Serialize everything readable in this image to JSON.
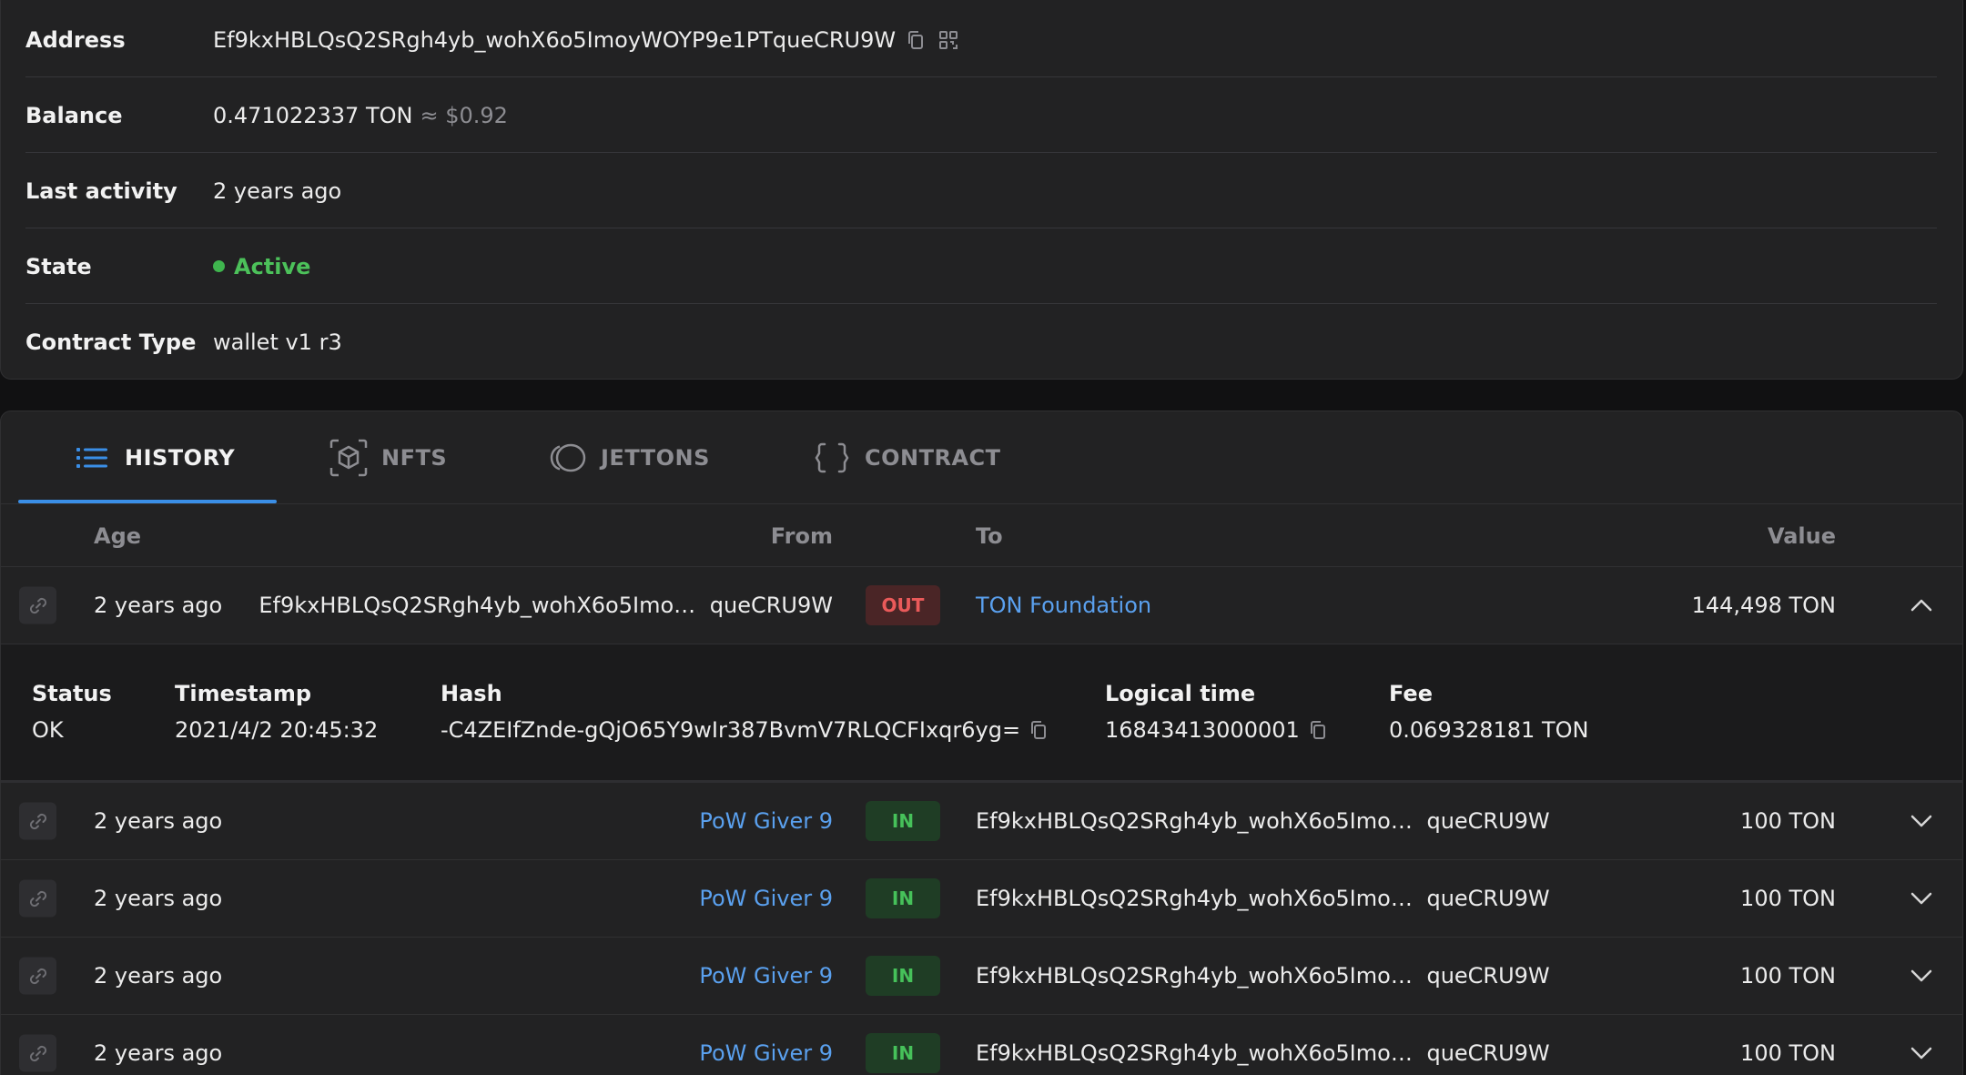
{
  "account": {
    "address_label": "Address",
    "address": "Ef9kxHBLQsQ2SRgh4yb_wohX6o5ImoyWOYP9e1PTqueCRU9W",
    "balance_label": "Balance",
    "balance": "0.471022337 TON",
    "balance_usd": "≈ $0.92",
    "last_activity_label": "Last activity",
    "last_activity": "2 years ago",
    "state_label": "State",
    "state": "Active",
    "contract_type_label": "Contract Type",
    "contract_type": "wallet v1 r3"
  },
  "tabs": [
    {
      "label": "HISTORY",
      "icon": "list-icon",
      "active": true
    },
    {
      "label": "NFTS",
      "icon": "cube-icon",
      "active": false
    },
    {
      "label": "JETTONS",
      "icon": "coins-icon",
      "active": false
    },
    {
      "label": "CONTRACT",
      "icon": "braces-icon",
      "active": false
    }
  ],
  "table": {
    "columns": {
      "age": "Age",
      "from": "From",
      "to": "To",
      "value": "Value"
    },
    "rows": [
      {
        "age": "2 years ago",
        "from_a": "Ef9kxHBLQsQ2SRgh4yb_wohX6o5Imo…",
        "from_b": "queCRU9W",
        "direction": "OUT",
        "to": "TON Foundation",
        "value": "144,498 TON"
      },
      {
        "age": "2 years ago",
        "from": "PoW Giver 9",
        "direction": "IN",
        "to_a": "Ef9kxHBLQsQ2SRgh4yb_wohX6o5Imo…",
        "to_b": "queCRU9W",
        "value": "100 TON"
      },
      {
        "age": "2 years ago",
        "from": "PoW Giver 9",
        "direction": "IN",
        "to_a": "Ef9kxHBLQsQ2SRgh4yb_wohX6o5Imo…",
        "to_b": "queCRU9W",
        "value": "100 TON"
      },
      {
        "age": "2 years ago",
        "from": "PoW Giver 9",
        "direction": "IN",
        "to_a": "Ef9kxHBLQsQ2SRgh4yb_wohX6o5Imo…",
        "to_b": "queCRU9W",
        "value": "100 TON"
      },
      {
        "age": "2 years ago",
        "from": "PoW Giver 9",
        "direction": "IN",
        "to_a": "Ef9kxHBLQsQ2SRgh4yb_wohX6o5Imo…",
        "to_b": "queCRU9W",
        "value": "100 TON"
      }
    ]
  },
  "details": {
    "status_label": "Status",
    "status": "OK",
    "timestamp_label": "Timestamp",
    "timestamp": "2021/4/2 20:45:32",
    "hash_label": "Hash",
    "hash": "-C4ZEIfZnde-gQjO65Y9wIr387BvmV7RLQCFIxqr6yg=",
    "lt_label": "Logical time",
    "lt": "16843413000001",
    "fee_label": "Fee",
    "fee": "0.069328181 TON"
  },
  "colors": {
    "accent": "#3a8ee6",
    "out": "#ea5a5a",
    "in": "#46c15a",
    "link": "#5aa0ee"
  }
}
